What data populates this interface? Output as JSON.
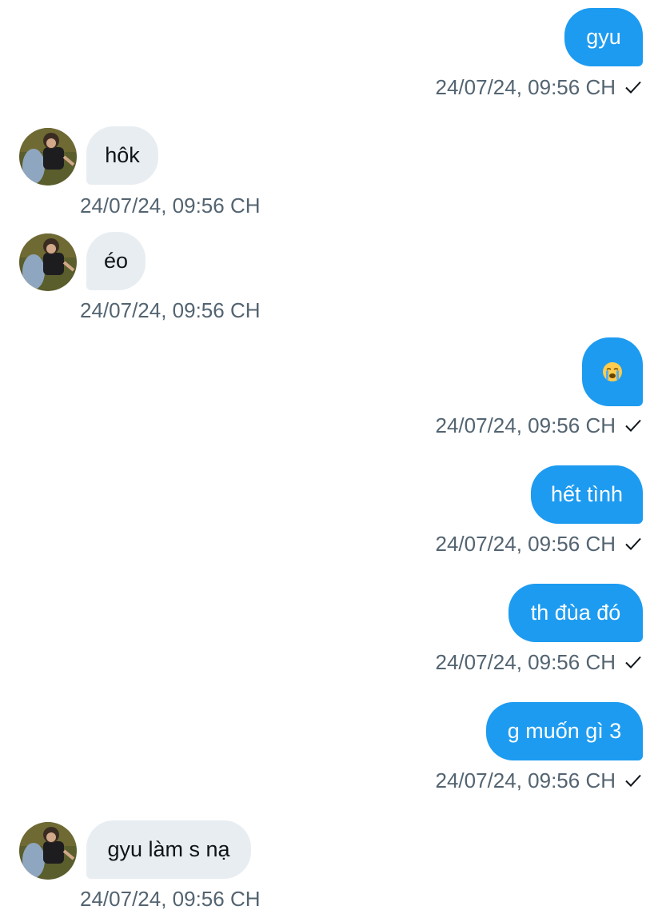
{
  "colors": {
    "outgoing_bubble": "#1d9bf0",
    "incoming_bubble": "#e8edf1",
    "timestamp": "#536471"
  },
  "messages": [
    {
      "direction": "outgoing",
      "text": "gyu",
      "time": "24/07/24, 09:56 CH",
      "status_icon": "sent-check-icon"
    },
    {
      "direction": "incoming",
      "text": "hôk",
      "time": "24/07/24, 09:56 CH",
      "avatar": "avatar"
    },
    {
      "direction": "incoming",
      "text": "éo",
      "time": "24/07/24, 09:56 CH",
      "avatar": "avatar"
    },
    {
      "direction": "outgoing",
      "text": "😭",
      "time": "24/07/24, 09:56 CH",
      "status_icon": "sent-check-icon"
    },
    {
      "direction": "outgoing",
      "text": "hết tình",
      "time": "24/07/24, 09:56 CH",
      "status_icon": "sent-check-icon"
    },
    {
      "direction": "outgoing",
      "text": "th đùa đó",
      "time": "24/07/24, 09:56 CH",
      "status_icon": "sent-check-icon"
    },
    {
      "direction": "outgoing",
      "text": "g muốn gì 3",
      "time": "24/07/24, 09:56 CH",
      "status_icon": "sent-check-icon"
    },
    {
      "direction": "incoming",
      "text": "gyu làm s nạ",
      "time": "24/07/24, 09:56 CH",
      "avatar": "avatar"
    }
  ]
}
